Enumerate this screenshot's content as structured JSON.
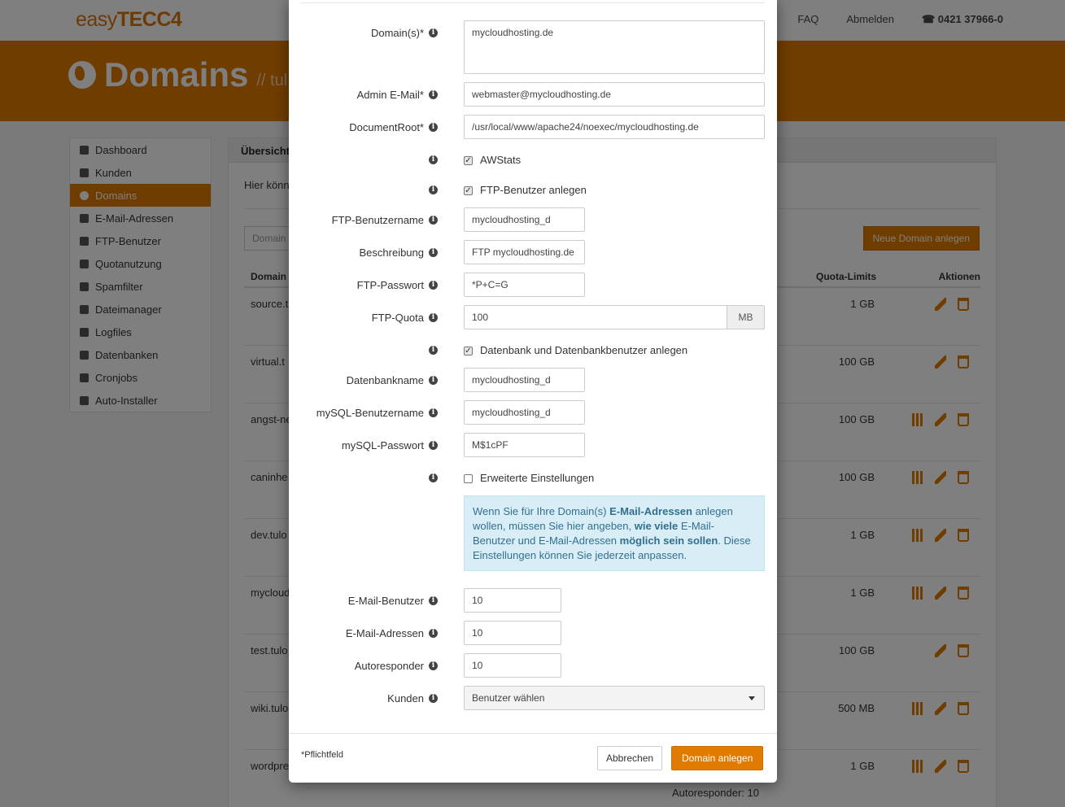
{
  "brand": {
    "logo_prefix": "easy",
    "logo_strong": "TECC4"
  },
  "topnav": {
    "faq": "FAQ",
    "logout": "Abmelden",
    "phone": "0421 37966-0"
  },
  "banner": {
    "title": "Domains",
    "subtitle": "// tul"
  },
  "sidebar": {
    "items": [
      {
        "label": "Dashboard",
        "icon": "dashboard-icon"
      },
      {
        "label": "Kunden",
        "icon": "users-icon"
      },
      {
        "label": "Domains",
        "icon": "globe-icon",
        "active": true
      },
      {
        "label": "E-Mail-Adressen",
        "icon": "envelope-icon"
      },
      {
        "label": "FTP-Benutzer",
        "icon": "user-icon"
      },
      {
        "label": "Quotanutzung",
        "icon": "quota-icon"
      },
      {
        "label": "Spamfilter",
        "icon": "filter-icon"
      },
      {
        "label": "Dateimanager",
        "icon": "folder-icon"
      },
      {
        "label": "Logfiles",
        "icon": "calendar-icon"
      },
      {
        "label": "Datenbanken",
        "icon": "list-icon"
      },
      {
        "label": "Cronjobs",
        "icon": "clock-icon"
      },
      {
        "label": "Auto-Installer",
        "icon": "wand-icon"
      }
    ]
  },
  "content": {
    "tab": "Übersicht",
    "intro": "Hier könn",
    "search_placeholder": "Domain",
    "new_button": "Neue Domain anlegen",
    "columns": {
      "domain": "Domain",
      "quota": "Quota-Limits",
      "actions": "Aktionen"
    },
    "rows": [
      {
        "domain": "source.t",
        "quota": "1 GB",
        "stats": false
      },
      {
        "domain": "virtual.t",
        "quota": "100 GB",
        "stats": false
      },
      {
        "domain": "angst-ne",
        "quota": "100 GB",
        "stats": true
      },
      {
        "domain": "caninhe",
        "quota": "100 GB",
        "stats": true
      },
      {
        "domain": "dev.tulo",
        "quota": "1 GB",
        "stats": true
      },
      {
        "domain": "mycloud",
        "quota": "1 GB",
        "stats": true
      },
      {
        "domain": "test.tulo",
        "quota": "100 GB",
        "stats": false
      },
      {
        "domain": "wiki.tulo",
        "quota": "500 MB",
        "stats": true
      },
      {
        "domain": "wordpre",
        "quota": "1 GB",
        "stats": true
      }
    ],
    "autoresponder_note": "Autoresponder: 10"
  },
  "modal": {
    "domains": {
      "label": "Domain(s)*",
      "value": "mycloudhosting.de"
    },
    "admin_email": {
      "label": "Admin E-Mail*",
      "value": "webmaster@mycloudhosting.de"
    },
    "document_root": {
      "label": "DocumentRoot*",
      "value": "/usr/local/www/apache24/noexec/mycloudhosting.de"
    },
    "awstats": {
      "label": "AWStats",
      "checked": true
    },
    "ftp_create": {
      "label": "FTP-Benutzer anlegen",
      "checked": true
    },
    "ftp_username": {
      "label": "FTP-Benutzername",
      "value": "mycloudhosting_d"
    },
    "description": {
      "label": "Beschreibung",
      "value": "FTP mycloudhosting.de"
    },
    "ftp_password": {
      "label": "FTP-Passwort",
      "value": "*P+C=G"
    },
    "ftp_quota": {
      "label": "FTP-Quota",
      "value": "100",
      "unit": "MB"
    },
    "db_create": {
      "label": "Datenbank und Datenbankbenutzer anlegen",
      "checked": true
    },
    "db_name": {
      "label": "Datenbankname",
      "value": "mycloudhosting_d"
    },
    "mysql_user": {
      "label": "mySQL-Benutzername",
      "value": "mycloudhosting_d"
    },
    "mysql_password": {
      "label": "mySQL-Passwort",
      "value": "M$1cPF"
    },
    "advanced": {
      "label": "Erweiterte Einstellungen",
      "checked": false
    },
    "alert": {
      "t1": "Wenn Sie für Ihre Domain(s) ",
      "b1": "E-Mail-Adressen",
      "t2": " anlegen wollen, müssen Sie hier angeben, ",
      "b2": "wie viele",
      "t3": " E-Mail-Benutzer und E-Mail-Adressen ",
      "b3": "möglich sein sollen",
      "t4": ". Diese Einstellungen können Sie jederzeit anpassen."
    },
    "email_users": {
      "label": "E-Mail-Benutzer",
      "value": "10"
    },
    "email_addresses": {
      "label": "E-Mail-Adressen",
      "value": "10"
    },
    "autoresponder": {
      "label": "Autoresponder",
      "value": "10"
    },
    "customers": {
      "label": "Kunden",
      "value": "Benutzer wählen"
    },
    "required_note": "*Pflichtfeld",
    "cancel": "Abbrechen",
    "submit": "Domain anlegen"
  },
  "colors": {
    "accent": "#e07b00",
    "alert_bg": "#d9edf7",
    "alert_text": "#31708f"
  }
}
